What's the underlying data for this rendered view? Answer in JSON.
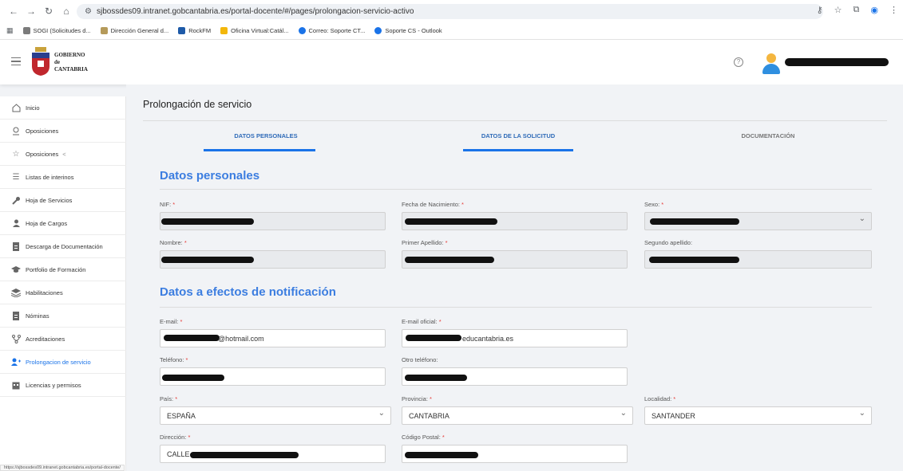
{
  "browser": {
    "url": "sjbossdes09.intranet.gobcantabria.es/portal-docente/#/pages/prolongacion-servicio-activo",
    "bookmarks": [
      {
        "label": "SOGI (Solicitudes d...",
        "color": "#7b7b7b"
      },
      {
        "label": "Dirección General d...",
        "color": "#b59a5a"
      },
      {
        "label": "RockFM",
        "color": "#1e5aa8"
      },
      {
        "label": "Oficina Virtual:Catál...",
        "color": "#f3b70b"
      },
      {
        "label": "Correo: Soporte CT...",
        "color": "#1a73e8"
      },
      {
        "label": "Soporte CS - Outlook",
        "color": "#1a73e8"
      }
    ]
  },
  "header": {
    "logo_line1": "GOBIERNO",
    "logo_line2": "de",
    "logo_line3": "CANTABRIA",
    "help_glyph": "?"
  },
  "sidebar": {
    "items": [
      {
        "label": "Inicio",
        "icon": "home-icon"
      },
      {
        "label": "Oposiciones",
        "icon": "user-search-icon"
      },
      {
        "label": "Oposiciones",
        "icon": "star-icon",
        "arrow": "<"
      },
      {
        "label": "Listas de interinos",
        "icon": "list-icon"
      },
      {
        "label": "Hoja de Servicios",
        "icon": "wrench-icon"
      },
      {
        "label": "Hoja de Cargos",
        "icon": "users-icon"
      },
      {
        "label": "Descarga de Documentación",
        "icon": "document-icon"
      },
      {
        "label": "Portfolio de Formación",
        "icon": "graduation-icon"
      },
      {
        "label": "Habilitaciones",
        "icon": "layers-icon"
      },
      {
        "label": "Nóminas",
        "icon": "document-icon"
      },
      {
        "label": "Acreditaciones",
        "icon": "branch-icon"
      },
      {
        "label": "Prolongacion de servicio",
        "icon": "user-add-icon",
        "active": true
      },
      {
        "label": "Licencias y permisos",
        "icon": "calendar-icon"
      }
    ]
  },
  "main": {
    "title": "Prolongación de servicio",
    "tabs": [
      {
        "label": "DATOS PERSONALES",
        "active": true
      },
      {
        "label": "DATOS DE LA SOLICITUD",
        "active": true
      },
      {
        "label": "DOCUMENTACIÓN",
        "active": false
      }
    ],
    "section1": "Datos personales",
    "section2": "Datos a efectos de notificación",
    "fields": {
      "nif": {
        "label": "NIF:",
        "required": "*"
      },
      "fecha": {
        "label": "Fecha de Nacimiento:",
        "required": "*"
      },
      "sexo": {
        "label": "Sexo:",
        "required": "*"
      },
      "nombre": {
        "label": "Nombre:",
        "required": "*"
      },
      "apellido1": {
        "label": "Primer Apellido:",
        "required": "*"
      },
      "apellido2": {
        "label": "Segundo apellido:",
        "required": ""
      },
      "email": {
        "label": "E-mail:",
        "required": "*",
        "value_suffix": "@hotmail.com"
      },
      "email_oficial": {
        "label": "E-mail oficial:",
        "required": "*",
        "value_suffix": "educantabria.es"
      },
      "telefono": {
        "label": "Teléfono:",
        "required": "*"
      },
      "otro_telefono": {
        "label": "Otro teléfono:",
        "required": ""
      },
      "pais": {
        "label": "País:",
        "required": "*",
        "value": "ESPAÑA"
      },
      "provincia": {
        "label": "Provincia:",
        "required": "*",
        "value": "CANTABRIA"
      },
      "localidad": {
        "label": "Localidad:",
        "required": "*",
        "value": "SANTANDER"
      },
      "direccion": {
        "label": "Dirección:",
        "required": "*",
        "value_prefix": "CALLE"
      },
      "codigo_postal": {
        "label": "Código Postal:",
        "required": "*"
      }
    }
  },
  "status_url": "https://sjbossdes09.intranet.gobcantabria.es/portal-docente/",
  "colors": {
    "accent": "#3b7de0",
    "tab": "#2f6bb8",
    "required": "#e53935"
  }
}
